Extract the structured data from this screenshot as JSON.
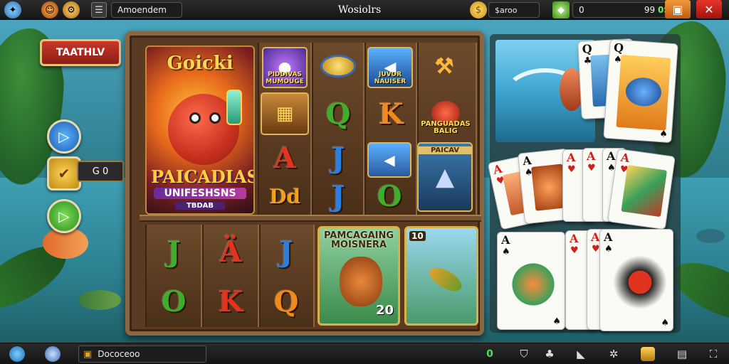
{
  "topbar": {
    "name_text": "Amoendem",
    "title": "Wosiolrs",
    "coin_value": "$aroo",
    "gem_value": "0",
    "balance_right": "99",
    "balance_suffix": "0S"
  },
  "left": {
    "banner_label": "TAATHLV",
    "coin_box_value": "G 0"
  },
  "feature": {
    "title": "Goicki",
    "banner": "PAICADIAS",
    "subtitle": "UNIFESHSNS",
    "tag": "TBDAB"
  },
  "reels": {
    "top_pics": [
      {
        "caption": "PIDDIVAS MUMOUGE"
      },
      {
        "caption": "JUVOR NAUISER"
      },
      {
        "caption": ""
      }
    ],
    "banner_pic": {
      "caption": "PAICAV"
    },
    "sym_red_caption": "PANGUADAS BALIG",
    "letters_top": [
      {
        "char": "Q",
        "color": "#3fae2a"
      },
      {
        "char": "K",
        "color": "#f08a1c"
      },
      {
        "char": "A",
        "color": "#e0341e"
      },
      {
        "char": "J",
        "color": "#2a7fe0"
      },
      {
        "char": "Dd",
        "color": "#f0a21c"
      },
      {
        "char": "J",
        "color": "#2a7fe0"
      },
      {
        "char": "O",
        "color": "#3fae2a"
      }
    ],
    "letters_bottom": [
      {
        "char": "J",
        "color": "#3fae2a"
      },
      {
        "char": "Ä",
        "color": "#e0341e"
      },
      {
        "char": "J",
        "color": "#2a7fe0"
      },
      {
        "char": "O",
        "color": "#3fae2a"
      },
      {
        "char": "K",
        "color": "#e0341e"
      },
      {
        "char": "Q",
        "color": "#f08a1c"
      }
    ],
    "card_a_title": "PAMCAGAING MOISNERA",
    "card_a_num": "20",
    "card_b_num": "10"
  },
  "panel": {
    "cards_top": [
      {
        "rank": "Q",
        "suit": "♣",
        "color": "#111"
      },
      {
        "rank": "Q",
        "suit": "♠",
        "color": "#111"
      }
    ],
    "cards_mid": [
      {
        "rank": "A",
        "suit": "♥",
        "color": "#d0201a"
      },
      {
        "rank": "A",
        "suit": "♠",
        "color": "#111"
      },
      {
        "rank": "A",
        "suit": "♥",
        "color": "#d0201a"
      },
      {
        "rank": "A",
        "suit": "♥",
        "color": "#d0201a"
      },
      {
        "rank": "A",
        "suit": "♠",
        "color": "#111"
      },
      {
        "rank": "A",
        "suit": "♥",
        "color": "#d0201a"
      }
    ],
    "cards_bot": [
      {
        "rank": "A",
        "suit": "♠",
        "color": "#111"
      },
      {
        "rank": "A",
        "suit": "♥",
        "color": "#d0201a"
      },
      {
        "rank": "A",
        "suit": "♥",
        "color": "#d0201a"
      },
      {
        "rank": "A",
        "suit": "♠",
        "color": "#111"
      }
    ]
  },
  "bottombar": {
    "status_text": "Dococeoo",
    "counter": "0"
  },
  "colors": {
    "accent_red": "#c9372a",
    "frame_wood": "#8b6640",
    "close_red": "#c8201a",
    "orange_btn": "#e07a1c"
  }
}
